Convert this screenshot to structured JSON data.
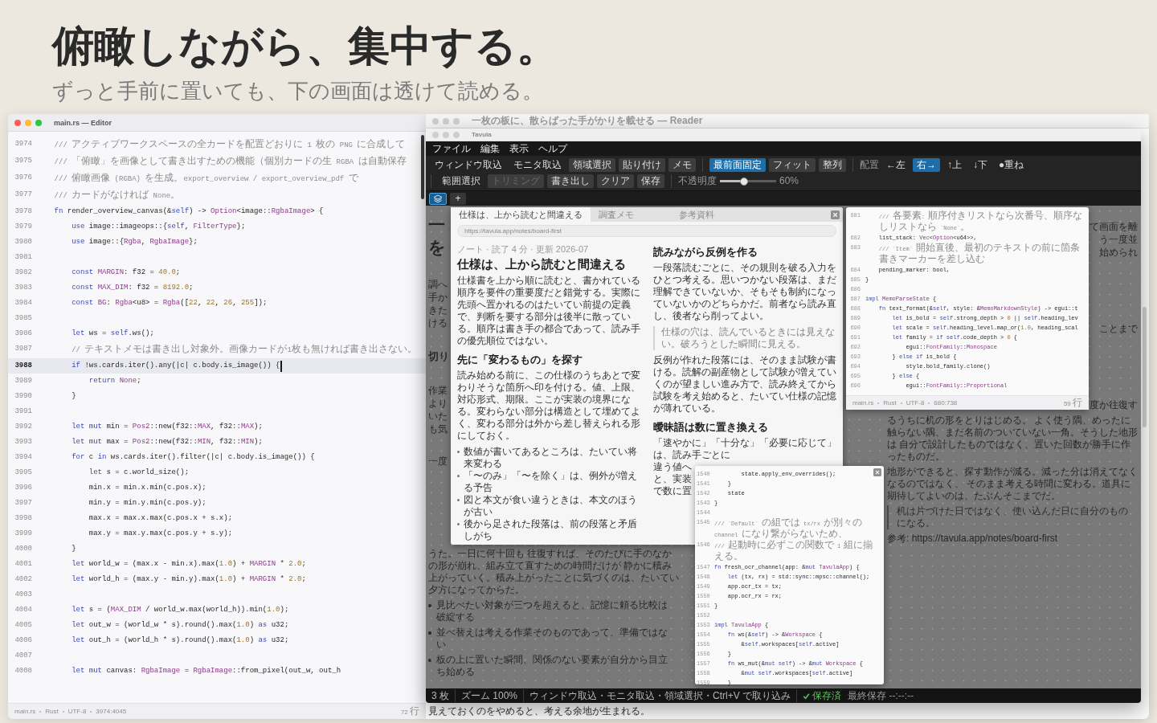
{
  "hero": {
    "title": "俯瞰しながら、集中する。",
    "subtitle": "ずっと手前に置いても、下の画面は透けて読める。"
  },
  "editor": {
    "title": "main.rs — Editor",
    "active": true,
    "lines": [
      {
        "number": "3974",
        "selected": false,
        "tokens": [
          {
            "kind": "comment",
            "text": "    /// アクティブワークスペースの全カードを配置どおりに 1 枚の PNG に合成して"
          }
        ]
      },
      {
        "number": "3975",
        "selected": false,
        "tokens": [
          {
            "kind": "comment",
            "text": "    /// 「俯瞰」を画像として書き出すための機能（個別カードの生 RGBA は自動保存"
          }
        ]
      },
      {
        "number": "3976",
        "selected": false,
        "tokens": [
          {
            "kind": "comment",
            "text": "    /// 俯瞰画像 (RGBA) を生成。export_overview / export_overview_pdf で"
          }
        ]
      },
      {
        "number": "3977",
        "selected": false,
        "tokens": [
          {
            "kind": "comment",
            "text": "    /// カードがなければ None。"
          }
        ]
      },
      {
        "number": "3978",
        "selected": false,
        "tokens": [
          {
            "kind": "kw",
            "text": "    fn"
          },
          {
            "kind": "plain",
            "text": " render_overview_canvas(&"
          },
          {
            "kind": "kw",
            "text": "self"
          },
          {
            "kind": "plain",
            "text": ") -> "
          },
          {
            "kind": "type",
            "text": "Option"
          },
          {
            "kind": "plain",
            "text": "<image::"
          },
          {
            "kind": "type",
            "text": "RgbaImage"
          },
          {
            "kind": "plain",
            "text": "> {"
          }
        ]
      },
      {
        "number": "3979",
        "selected": false,
        "tokens": [
          {
            "kind": "kw",
            "text": "        use"
          },
          {
            "kind": "plain",
            "text": " image::imageops::{"
          },
          {
            "kind": "kw",
            "text": "self"
          },
          {
            "kind": "plain",
            "text": ", "
          },
          {
            "kind": "type",
            "text": "FilterType"
          },
          {
            "kind": "plain",
            "text": "};"
          }
        ]
      },
      {
        "number": "3980",
        "selected": false,
        "tokens": [
          {
            "kind": "kw",
            "text": "        use"
          },
          {
            "kind": "plain",
            "text": " image::{"
          },
          {
            "kind": "type",
            "text": "Rgba"
          },
          {
            "kind": "plain",
            "text": ", "
          },
          {
            "kind": "type",
            "text": "RgbaImage"
          },
          {
            "kind": "plain",
            "text": "};"
          }
        ]
      },
      {
        "number": "3981",
        "selected": false
      },
      {
        "number": "3982",
        "selected": false,
        "tokens": [
          {
            "kind": "kw",
            "text": "        const "
          },
          {
            "kind": "type",
            "text": "MARGIN"
          },
          {
            "kind": "plain",
            "text": ": f32 = "
          },
          {
            "kind": "num",
            "text": "40.0"
          },
          {
            "kind": "plain",
            "text": ";"
          }
        ]
      },
      {
        "number": "3983",
        "selected": false,
        "tokens": [
          {
            "kind": "kw",
            "text": "        const "
          },
          {
            "kind": "type",
            "text": "MAX_DIM"
          },
          {
            "kind": "plain",
            "text": ": f32 = "
          },
          {
            "kind": "num",
            "text": "8192.0"
          },
          {
            "kind": "plain",
            "text": ";"
          }
        ]
      },
      {
        "number": "3984",
        "selected": false,
        "tokens": [
          {
            "kind": "kw",
            "text": "        const "
          },
          {
            "kind": "type",
            "text": "BG"
          },
          {
            "kind": "plain",
            "text": ": "
          },
          {
            "kind": "type",
            "text": "Rgba"
          },
          {
            "kind": "plain",
            "text": "<u8> = "
          },
          {
            "kind": "type",
            "text": "Rgba"
          },
          {
            "kind": "plain",
            "text": "(["
          },
          {
            "kind": "num",
            "text": "22"
          },
          {
            "kind": "plain",
            "text": ", "
          },
          {
            "kind": "num",
            "text": "22"
          },
          {
            "kind": "plain",
            "text": ", "
          },
          {
            "kind": "num",
            "text": "26"
          },
          {
            "kind": "plain",
            "text": ", "
          },
          {
            "kind": "num",
            "text": "255"
          },
          {
            "kind": "plain",
            "text": "]);"
          }
        ]
      },
      {
        "number": "3985",
        "selected": false
      },
      {
        "number": "3986",
        "selected": false,
        "tokens": [
          {
            "kind": "kw",
            "text": "        let"
          },
          {
            "kind": "plain",
            "text": " ws = "
          },
          {
            "kind": "kw",
            "text": "self"
          },
          {
            "kind": "plain",
            "text": ".ws();"
          }
        ]
      },
      {
        "number": "3987",
        "selected": false,
        "tokens": [
          {
            "kind": "comment",
            "text": "        // テキストメモは書き出し対象外。画像カードが1枚も無ければ書き出さない。"
          }
        ]
      },
      {
        "number": "3988",
        "selected": true,
        "tokens": [
          {
            "kind": "kw",
            "text": "        if"
          },
          {
            "kind": "plain",
            "text": " !ws.cards.iter().any(|c| c.body.is_image()) {"
          }
        ]
      },
      {
        "number": "3989",
        "selected": false,
        "tokens": [
          {
            "kind": "kw",
            "text": "            return "
          },
          {
            "kind": "type",
            "text": "None"
          },
          {
            "kind": "plain",
            "text": ";"
          }
        ]
      },
      {
        "number": "3990",
        "selected": false,
        "tokens": [
          {
            "kind": "plain",
            "text": "        }"
          }
        ]
      },
      {
        "number": "3991",
        "selected": false
      },
      {
        "number": "3992",
        "selected": false,
        "tokens": [
          {
            "kind": "kw",
            "text": "        let mut"
          },
          {
            "kind": "plain",
            "text": " min = "
          },
          {
            "kind": "type",
            "text": "Pos2"
          },
          {
            "kind": "plain",
            "text": "::new(f32::"
          },
          {
            "kind": "type",
            "text": "MAX"
          },
          {
            "kind": "plain",
            "text": ", f32::"
          },
          {
            "kind": "type",
            "text": "MAX"
          },
          {
            "kind": "plain",
            "text": ");"
          }
        ]
      },
      {
        "number": "3993",
        "selected": false,
        "tokens": [
          {
            "kind": "kw",
            "text": "        let mut"
          },
          {
            "kind": "plain",
            "text": " max = "
          },
          {
            "kind": "type",
            "text": "Pos2"
          },
          {
            "kind": "plain",
            "text": "::new(f32::"
          },
          {
            "kind": "type",
            "text": "MIN"
          },
          {
            "kind": "plain",
            "text": ", f32::"
          },
          {
            "kind": "type",
            "text": "MIN"
          },
          {
            "kind": "plain",
            "text": ");"
          }
        ]
      },
      {
        "number": "3994",
        "selected": false,
        "tokens": [
          {
            "kind": "kw",
            "text": "        for"
          },
          {
            "kind": "plain",
            "text": " c "
          },
          {
            "kind": "kw",
            "text": "in"
          },
          {
            "kind": "plain",
            "text": " ws.cards.iter().filter(|c| c.body.is_image()) {"
          }
        ]
      },
      {
        "number": "3995",
        "selected": false,
        "tokens": [
          {
            "kind": "kw",
            "text": "            let"
          },
          {
            "kind": "plain",
            "text": " s = c.world_size();"
          }
        ]
      },
      {
        "number": "3996",
        "selected": false,
        "tokens": [
          {
            "kind": "plain",
            "text": "            min.x = min.x.min(c.pos.x);"
          }
        ]
      },
      {
        "number": "3997",
        "selected": false,
        "tokens": [
          {
            "kind": "plain",
            "text": "            min.y = min.y.min(c.pos.y);"
          }
        ]
      },
      {
        "number": "3998",
        "selected": false,
        "tokens": [
          {
            "kind": "plain",
            "text": "            max.x = max.x.max(c.pos.x + s.x);"
          }
        ]
      },
      {
        "number": "3999",
        "selected": false,
        "tokens": [
          {
            "kind": "plain",
            "text": "            max.y = max.y.max(c.pos.y + s.y);"
          }
        ]
      },
      {
        "number": "4000",
        "selected": false,
        "tokens": [
          {
            "kind": "plain",
            "text": "        }"
          }
        ]
      },
      {
        "number": "4001",
        "selected": false,
        "tokens": [
          {
            "kind": "kw",
            "text": "        let"
          },
          {
            "kind": "plain",
            "text": " world_w = (max.x - min.x).max("
          },
          {
            "kind": "num",
            "text": "1.0"
          },
          {
            "kind": "plain",
            "text": ") + "
          },
          {
            "kind": "type",
            "text": "MARGIN"
          },
          {
            "kind": "plain",
            "text": " * "
          },
          {
            "kind": "num",
            "text": "2.0"
          },
          {
            "kind": "plain",
            "text": ";"
          }
        ]
      },
      {
        "number": "4002",
        "selected": false,
        "tokens": [
          {
            "kind": "kw",
            "text": "        let"
          },
          {
            "kind": "plain",
            "text": " world_h = (max.y - min.y).max("
          },
          {
            "kind": "num",
            "text": "1.0"
          },
          {
            "kind": "plain",
            "text": ") + "
          },
          {
            "kind": "type",
            "text": "MARGIN"
          },
          {
            "kind": "plain",
            "text": " * "
          },
          {
            "kind": "num",
            "text": "2.0"
          },
          {
            "kind": "plain",
            "text": ";"
          }
        ]
      },
      {
        "number": "4003",
        "selected": false
      },
      {
        "number": "4004",
        "selected": false,
        "tokens": [
          {
            "kind": "kw",
            "text": "        let"
          },
          {
            "kind": "plain",
            "text": " s = ("
          },
          {
            "kind": "type",
            "text": "MAX_DIM"
          },
          {
            "kind": "plain",
            "text": " / world_w.max(world_h)).min("
          },
          {
            "kind": "num",
            "text": "1.0"
          },
          {
            "kind": "plain",
            "text": ");"
          }
        ]
      },
      {
        "number": "4005",
        "selected": false,
        "tokens": [
          {
            "kind": "kw",
            "text": "        let"
          },
          {
            "kind": "plain",
            "text": " out_w = (world_w * s).round().max("
          },
          {
            "kind": "num",
            "text": "1.0"
          },
          {
            "kind": "plain",
            "text": ") "
          },
          {
            "kind": "kw",
            "text": "as"
          },
          {
            "kind": "plain",
            "text": " u32;"
          }
        ]
      },
      {
        "number": "4006",
        "selected": false,
        "tokens": [
          {
            "kind": "kw",
            "text": "        let"
          },
          {
            "kind": "plain",
            "text": " out_h = (world_h * s).round().max("
          },
          {
            "kind": "num",
            "text": "1.0"
          },
          {
            "kind": "plain",
            "text": ") "
          },
          {
            "kind": "kw",
            "text": "as"
          },
          {
            "kind": "plain",
            "text": " u32;"
          }
        ]
      },
      {
        "number": "4007",
        "selected": false
      },
      {
        "number": "4008",
        "selected": false,
        "tokens": [
          {
            "kind": "kw",
            "text": "        let mut"
          },
          {
            "kind": "plain",
            "text": " canvas: "
          },
          {
            "kind": "type",
            "text": "RgbaImage"
          },
          {
            "kind": "plain",
            "text": " = "
          },
          {
            "kind": "type",
            "text": "RgbaImage"
          },
          {
            "kind": "plain",
            "text": "::from_pixel(out_w, out_h"
          }
        ]
      }
    ],
    "status": {
      "items": [
        "main.rs",
        "Rust",
        "UTF-8",
        "3974:4045"
      ],
      "line_count": "72 行"
    }
  },
  "reader": {
    "title": "一枚の板に、散らばった手がかりを載せる — Reader",
    "active": false,
    "left_fragments": [
      {
        "kind": "heading",
        "lines": [
          "一",
          "を"
        ]
      },
      {
        "kind": "text",
        "lines": [
          "調へ",
          "手か",
          "きた",
          "ける"
        ]
      },
      {
        "kind": "subheading",
        "lines": [
          "切り"
        ]
      },
      {
        "kind": "text",
        "lines": [
          "作業",
          "より",
          "いた",
          "も気"
        ]
      },
      {
        "kind": "text",
        "lines": [
          "一度"
        ]
      }
    ],
    "left_blocks": [
      {
        "kind": "paragraph",
        "lines": [
          "うた。一日に何十回も 往復すれば、そのたびに手のなか",
          "の形が崩れ、組み立て直すための時間だけが 静かに積み",
          "上がっていく。積み上がったことに気づくのは、たいてい",
          "夕方になってからだ。"
        ]
      },
      {
        "kind": "bullet",
        "lines": [
          "見比べたい対象が三つを超えると、記憶に頼る比較は",
          "破綻する"
        ]
      },
      {
        "kind": "bullet",
        "lines": [
          "並べ替えは考える作業そのものであって、準備ではな",
          "い"
        ]
      },
      {
        "kind": "bullet",
        "lines": [
          "板の上に置いた瞬間、関係のない要素が自分から目立",
          "ち始める"
        ]
      }
    ],
    "right_fragments": [
      {
        "kind": "text",
        "lines": [
          "て画面を離",
          "う一度並",
          "始められ"
        ]
      },
      {
        "kind": "text",
        "lines": [
          "ことまで"
        ]
      },
      {
        "kind": "text",
        "lines": [
          "度か往復す"
        ]
      }
    ],
    "right_blocks": [
      {
        "kind": "paragraph",
        "lines": [
          "るうちに机の形をとりはじめる。 よく使う隅、めったに",
          "触らない隅、まだ名前のついていない一角。そうした地形",
          "は 自分で設計したものではなく、置いた回数が勝手に作",
          "ったものだ。"
        ]
      },
      {
        "kind": "paragraph",
        "lines": [
          "地形ができると、探す動作が減る。減った分は消えてなく",
          "なるのではなく、 そのまま考える時間に変わる。道具に",
          "期待してよいのは、たぶんそこまでだ。"
        ]
      },
      {
        "kind": "quote",
        "lines": [
          "机は片づけた日ではなく、使い込んだ日に自分のもの",
          "になる。"
        ]
      },
      {
        "kind": "paragraph",
        "lines": [
          "参考: https://tavula.app/notes/board-first"
        ]
      }
    ],
    "bottom_line": "見えておくのをやめると、考える余地が生まれる。"
  },
  "tavula": {
    "title": "Tavula",
    "active": false,
    "menu": [
      "ファイル",
      "編集",
      "表示",
      "ヘルプ"
    ],
    "toolbar": [
      {
        "items": [
          {
            "kind": "flat",
            "label": "ウィンドウ取込",
            "selected": false,
            "disabled": false
          },
          {
            "kind": "flat",
            "label": "モニタ取込",
            "selected": false,
            "disabled": false
          },
          {
            "kind": "button",
            "label": "領域選択",
            "selected": false,
            "disabled": false
          },
          {
            "kind": "button",
            "label": "貼り付け",
            "selected": false,
            "disabled": false
          },
          {
            "kind": "button",
            "label": "メモ",
            "selected": false,
            "disabled": false
          }
        ]
      },
      {
        "items": [
          {
            "kind": "button",
            "label": "最前面固定",
            "selected": true,
            "disabled": false
          },
          {
            "kind": "button",
            "label": "フィット",
            "selected": false,
            "disabled": false
          },
          {
            "kind": "button",
            "label": "整列",
            "selected": false,
            "disabled": false
          }
        ]
      },
      {
        "items": [
          {
            "kind": "label",
            "label": "配置"
          },
          {
            "kind": "flat",
            "label": "←左",
            "selected": false,
            "disabled": false
          },
          {
            "kind": "flat",
            "label": "右→",
            "selected": true,
            "disabled": false
          },
          {
            "kind": "flat",
            "label": "↑上",
            "selected": false,
            "disabled": false
          },
          {
            "kind": "flat",
            "label": "↓下",
            "selected": false,
            "disabled": false
          },
          {
            "kind": "flat",
            "label": "●重ね",
            "selected": false,
            "disabled": false
          }
        ]
      },
      {
        "items": [
          {
            "kind": "flat",
            "label": "範囲選択",
            "selected": false,
            "disabled": false
          },
          {
            "kind": "button",
            "label": "トリミング",
            "selected": false,
            "disabled": true
          },
          {
            "kind": "button",
            "label": "書き出し",
            "selected": false,
            "disabled": false
          },
          {
            "kind": "button",
            "label": "クリア",
            "selected": false,
            "disabled": false
          },
          {
            "kind": "button",
            "label": "保存",
            "selected": false,
            "disabled": false
          }
        ]
      },
      {
        "items": [
          {
            "kind": "label",
            "label": "不透明度"
          },
          {
            "kind": "slider",
            "level": 0.42,
            "reading": "60%"
          }
        ]
      }
    ],
    "workspace_tabs": [
      {
        "selected": true
      }
    ],
    "add_tab": "+",
    "cards": [
      {
        "kind": "document",
        "tabs": [
          {
            "label": "仕様は、上から読むと間違える",
            "selected": true
          },
          {
            "label": "調査メモ",
            "selected": false
          },
          {
            "label": "参考資料",
            "selected": false
          }
        ],
        "url": "https://tavula.app/notes/board-first",
        "meta": "ノート · 読了 4 分 · 更新 2026-07",
        "title": "仕様は、上から読むと間違える",
        "columns": [
          [
            {
              "kind": "paragraph",
              "text": "仕様書を上から順に読むと、書かれている順序を要件の重要度だと錯覚する。実際に先頭へ置かれるのはたいてい前提の定義で、判断を要する部分は後半に散っている。順序は書き手の都合であって、読み手の優先順位ではない。"
            },
            {
              "kind": "heading",
              "text": "先に「変わるもの」を探す"
            },
            {
              "kind": "paragraph",
              "text": "読み始める前に、この仕様のうちあとで変わりそうな箇所へ印を付ける。値、上限、対応形式、期限。ここが実装の境界になる。変わらない部分は構造として埋めてよく、変わる部分は外から差し替えられる形にしておく。"
            },
            {
              "kind": "bullets",
              "items": [
                "数値が書いてあるところは、たいてい将来変わる",
                "「〜のみ」「〜を除く」は、例外が増える予告",
                "図と本文が食い違うときは、本文のほうが古い",
                "後から足された段落は、前の段落と矛盾しがち"
              ]
            }
          ],
          [
            {
              "kind": "heading",
              "text": "読みながら反例を作る"
            },
            {
              "kind": "paragraph",
              "text": "一段落読むごとに、その規則を破る入力をひとつ考える。思いつかない段落は、まだ理解できていないか、そもそも制約になっていないかのどちらかだ。前者なら読み直し、後者なら削ってよい。"
            },
            {
              "kind": "quote",
              "text": "仕様の穴は、読んでいるときには見えない。破ろうとした瞬間に見える。"
            },
            {
              "kind": "paragraph",
              "text": "反例が作れた段落には、そのまま試験が書ける。読解の副産物として試験が増えていくのが望ましい進み方で、読み終えてから試験を考え始めると、たいてい仕様の記憶が薄れている。"
            },
            {
              "kind": "heading",
              "text": "曖昧語は数に置き換える"
            },
            {
              "kind": "fragments",
              "lines": [
                "「速やかに」「十分な」「必要に応じて」は、読み手ごとに",
                "違う値へ",
                "と、実装",
                "で数に置"
              ]
            }
          ]
        ]
      },
      {
        "kind": "code",
        "closable": false,
        "lines": [
          {
            "number": "681",
            "tokens": [
              {
                "kind": "comment",
                "text": "    /// 各要素: 順序付きリストなら次番号、順序なしリストなら `None`。"
              }
            ]
          },
          {
            "number": "682",
            "tokens": [
              {
                "kind": "plain",
                "text": "    list_stack: "
              },
              {
                "kind": "type",
                "text": "Vec"
              },
              {
                "kind": "plain",
                "text": "<"
              },
              {
                "kind": "type",
                "text": "Option"
              },
              {
                "kind": "plain",
                "text": "<u64>>,"
              }
            ]
          },
          {
            "number": "683",
            "tokens": [
              {
                "kind": "comment",
                "text": "    /// `Item` 開始直後、最初のテキストの前に箇条書きマーカーを差し込む"
              }
            ]
          },
          {
            "number": "684",
            "tokens": [
              {
                "kind": "plain",
                "text": "    pending_marker: bool,"
              }
            ]
          },
          {
            "number": "685",
            "tokens": [
              {
                "kind": "plain",
                "text": "}"
              }
            ]
          },
          {
            "number": "686"
          },
          {
            "number": "687",
            "tokens": [
              {
                "kind": "kw",
                "text": "impl "
              },
              {
                "kind": "type",
                "text": "MemoParseState"
              },
              {
                "kind": "plain",
                "text": " {"
              }
            ]
          },
          {
            "number": "688",
            "tokens": [
              {
                "kind": "kw",
                "text": "    fn"
              },
              {
                "kind": "plain",
                "text": " text_format(&"
              },
              {
                "kind": "kw",
                "text": "self"
              },
              {
                "kind": "plain",
                "text": ", style: &"
              },
              {
                "kind": "type",
                "text": "MemoMarkdownStyle"
              },
              {
                "kind": "plain",
                "text": ") -> egui::t"
              }
            ]
          },
          {
            "number": "689",
            "tokens": [
              {
                "kind": "kw",
                "text": "        let"
              },
              {
                "kind": "plain",
                "text": " is_bold = "
              },
              {
                "kind": "kw",
                "text": "self"
              },
              {
                "kind": "plain",
                "text": ".strong_depth > "
              },
              {
                "kind": "num",
                "text": "0"
              },
              {
                "kind": "plain",
                "text": " || "
              },
              {
                "kind": "kw",
                "text": "self"
              },
              {
                "kind": "plain",
                "text": ".heading_lev"
              }
            ]
          },
          {
            "number": "690",
            "tokens": [
              {
                "kind": "kw",
                "text": "        let"
              },
              {
                "kind": "plain",
                "text": " scale = "
              },
              {
                "kind": "kw",
                "text": "self"
              },
              {
                "kind": "plain",
                "text": ".heading_level.map_or("
              },
              {
                "kind": "num",
                "text": "1.0"
              },
              {
                "kind": "plain",
                "text": ", heading_scal"
              }
            ]
          },
          {
            "number": "691",
            "tokens": [
              {
                "kind": "kw",
                "text": "        let"
              },
              {
                "kind": "plain",
                "text": " family = "
              },
              {
                "kind": "kw",
                "text": "if self"
              },
              {
                "kind": "plain",
                "text": ".code_depth > "
              },
              {
                "kind": "num",
                "text": "0"
              },
              {
                "kind": "plain",
                "text": " {"
              }
            ]
          },
          {
            "number": "692",
            "tokens": [
              {
                "kind": "plain",
                "text": "            egui::"
              },
              {
                "kind": "type",
                "text": "FontFamily"
              },
              {
                "kind": "plain",
                "text": "::"
              },
              {
                "kind": "type",
                "text": "Monospace"
              }
            ]
          },
          {
            "number": "693",
            "tokens": [
              {
                "kind": "plain",
                "text": "        } "
              },
              {
                "kind": "kw",
                "text": "else if"
              },
              {
                "kind": "plain",
                "text": " is_bold {"
              }
            ]
          },
          {
            "number": "694",
            "tokens": [
              {
                "kind": "plain",
                "text": "            style.bold_family.clone()"
              }
            ]
          },
          {
            "number": "695",
            "tokens": [
              {
                "kind": "plain",
                "text": "        } "
              },
              {
                "kind": "kw",
                "text": "else"
              },
              {
                "kind": "plain",
                "text": " {"
              }
            ]
          },
          {
            "number": "696",
            "tokens": [
              {
                "kind": "plain",
                "text": "            egui::"
              },
              {
                "kind": "type",
                "text": "FontFamily"
              },
              {
                "kind": "plain",
                "text": "::"
              },
              {
                "kind": "type",
                "text": "Proportional"
              }
            ]
          }
        ],
        "status": {
          "items": [
            "main.rs",
            "Rust",
            "UTF-8",
            "680:738"
          ],
          "line_count": "59 行"
        }
      },
      {
        "kind": "code",
        "closable": true,
        "lines": [
          {
            "number": "1540",
            "tokens": [
              {
                "kind": "plain",
                "text": "        state.apply_env_overrides();"
              }
            ]
          },
          {
            "number": "1541",
            "tokens": [
              {
                "kind": "plain",
                "text": "    }"
              }
            ]
          },
          {
            "number": "1542",
            "tokens": [
              {
                "kind": "plain",
                "text": "    state"
              }
            ]
          },
          {
            "number": "1543",
            "tokens": [
              {
                "kind": "plain",
                "text": "}"
              }
            ]
          },
          {
            "number": "1544"
          },
          {
            "number": "1545",
            "tokens": [
              {
                "kind": "comment",
                "text": "/// `Default` の組では tx/rx が別々の channel になり繋がらないため、"
              }
            ]
          },
          {
            "number": "1546",
            "tokens": [
              {
                "kind": "comment",
                "text": "/// 起動時に必ずこの関数で 1 組に揃える。"
              }
            ]
          },
          {
            "number": "1547",
            "tokens": [
              {
                "kind": "kw",
                "text": "fn"
              },
              {
                "kind": "plain",
                "text": " fresh_ocr_channel(app: &"
              },
              {
                "kind": "kw",
                "text": "mut "
              },
              {
                "kind": "type",
                "text": "TavulaApp"
              },
              {
                "kind": "plain",
                "text": ") {"
              }
            ]
          },
          {
            "number": "1548",
            "tokens": [
              {
                "kind": "kw",
                "text": "    let"
              },
              {
                "kind": "plain",
                "text": " (tx, rx) = std::sync::mpsc::channel();"
              }
            ]
          },
          {
            "number": "1549",
            "tokens": [
              {
                "kind": "plain",
                "text": "    app.ocr_tx = tx;"
              }
            ]
          },
          {
            "number": "1550",
            "tokens": [
              {
                "kind": "plain",
                "text": "    app.ocr_rx = rx;"
              }
            ]
          },
          {
            "number": "1551",
            "tokens": [
              {
                "kind": "plain",
                "text": "}"
              }
            ]
          },
          {
            "number": "1552"
          },
          {
            "number": "1553",
            "tokens": [
              {
                "kind": "kw",
                "text": "impl "
              },
              {
                "kind": "type",
                "text": "TavulaApp"
              },
              {
                "kind": "plain",
                "text": " {"
              }
            ]
          },
          {
            "number": "1554",
            "tokens": [
              {
                "kind": "kw",
                "text": "    fn"
              },
              {
                "kind": "plain",
                "text": " ws(&"
              },
              {
                "kind": "kw",
                "text": "self"
              },
              {
                "kind": "plain",
                "text": ") -> &"
              },
              {
                "kind": "type",
                "text": "Workspace"
              },
              {
                "kind": "plain",
                "text": " {"
              }
            ]
          },
          {
            "number": "1555",
            "tokens": [
              {
                "kind": "plain",
                "text": "        &"
              },
              {
                "kind": "kw",
                "text": "self"
              },
              {
                "kind": "plain",
                "text": ".workspaces["
              },
              {
                "kind": "kw",
                "text": "self"
              },
              {
                "kind": "plain",
                "text": ".active]"
              }
            ]
          },
          {
            "number": "1556",
            "tokens": [
              {
                "kind": "plain",
                "text": "    }"
              }
            ]
          },
          {
            "number": "1557",
            "tokens": [
              {
                "kind": "kw",
                "text": "    fn"
              },
              {
                "kind": "plain",
                "text": " ws_mut(&"
              },
              {
                "kind": "kw",
                "text": "mut self"
              },
              {
                "kind": "plain",
                "text": ") -> &"
              },
              {
                "kind": "kw",
                "text": "mut "
              },
              {
                "kind": "type",
                "text": "Workspace"
              },
              {
                "kind": "plain",
                "text": " {"
              }
            ]
          },
          {
            "number": "1558",
            "tokens": [
              {
                "kind": "plain",
                "text": "        &"
              },
              {
                "kind": "kw",
                "text": "mut self"
              },
              {
                "kind": "plain",
                "text": ".workspaces["
              },
              {
                "kind": "kw",
                "text": "self"
              },
              {
                "kind": "plain",
                "text": ".active]"
              }
            ]
          },
          {
            "number": "1559",
            "tokens": [
              {
                "kind": "plain",
                "text": "    }"
              }
            ]
          }
        ]
      }
    ],
    "status": {
      "items": [
        "3 枚",
        "ズーム 100%",
        "ウィンドウ取込・モニタ取込・領域選択・Ctrl+V で取り込み"
      ],
      "save_state": "保存済",
      "last_saved": "最終保存 --:--:--"
    }
  }
}
